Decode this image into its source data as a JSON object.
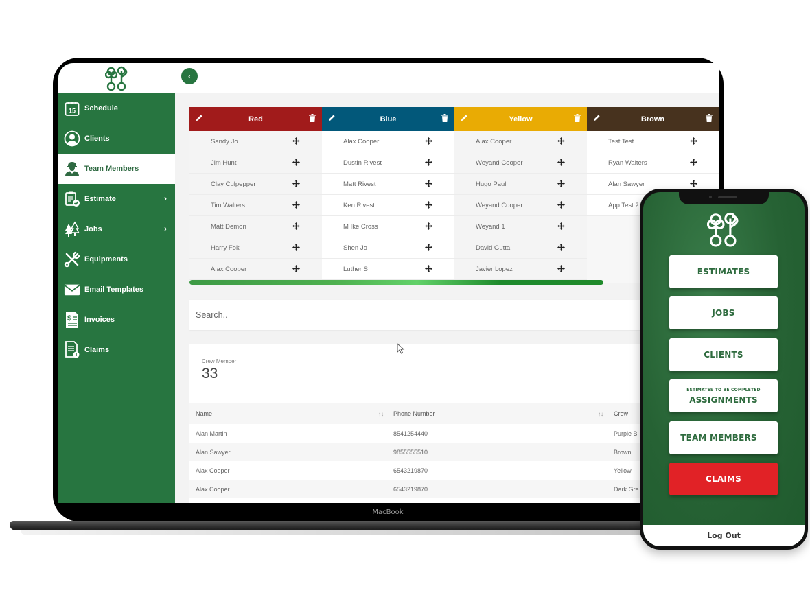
{
  "device": {
    "laptop_brand": "MacBook"
  },
  "sidebar": {
    "items": [
      {
        "label": "Schedule",
        "icon": "calendar-icon",
        "calendar_day": "15",
        "active": false,
        "has_submenu": false
      },
      {
        "label": "Clients",
        "icon": "user-circle-icon",
        "active": false,
        "has_submenu": false
      },
      {
        "label": "Team Members",
        "icon": "worker-icon",
        "active": true,
        "has_submenu": false
      },
      {
        "label": "Estimate",
        "icon": "clipboard-check-icon",
        "active": false,
        "has_submenu": true
      },
      {
        "label": "Jobs",
        "icon": "trees-icon",
        "active": false,
        "has_submenu": true
      },
      {
        "label": "Equipments",
        "icon": "tools-icon",
        "active": false,
        "has_submenu": false
      },
      {
        "label": "Email Templates",
        "icon": "envelope-icon",
        "active": false,
        "has_submenu": false
      },
      {
        "label": "Invoices",
        "icon": "invoice-icon",
        "active": false,
        "has_submenu": false
      },
      {
        "label": "Claims",
        "icon": "claims-doc-icon",
        "active": false,
        "has_submenu": false
      }
    ],
    "chevron": "›"
  },
  "topbar": {
    "back_glyph": "‹"
  },
  "crews": [
    {
      "name": "Red",
      "color": "#a11b1b",
      "members": [
        "Sandy Jo",
        "Jim Hunt",
        "Clay Culpepper",
        "Tim Walters",
        "Matt Demon",
        "Harry Fok",
        "Alax Cooper"
      ]
    },
    {
      "name": "Blue",
      "color": "#02587a",
      "members": [
        "Alax Cooper",
        "Dustin Rivest",
        "Matt Rivest",
        "Ken Rivest",
        "M Ike Cross",
        "Shen Jo",
        "Luther S"
      ]
    },
    {
      "name": "Yellow",
      "color": "#e9ab04",
      "members": [
        "Alax Cooper",
        "Weyand Cooper",
        "Hugo Paul",
        "Weyand Cooper",
        "Weyand 1",
        "David Gutta",
        "Javier Lopez"
      ]
    },
    {
      "name": "Brown",
      "color": "#47321e",
      "members": [
        "Test Test",
        "Ryan Walters",
        "Alan Sawyer",
        "App Test 2"
      ]
    }
  ],
  "search": {
    "placeholder": "Search.."
  },
  "stats": {
    "label": "Crew Member",
    "value": "33"
  },
  "table": {
    "headers": [
      "Name",
      "Phone Number",
      "Crew"
    ],
    "sort_glyph": "↑↓",
    "rows": [
      [
        "Alan Martin",
        "8541254440",
        "Purple B"
      ],
      [
        "Alan Sawyer",
        "9855555510",
        "Brown"
      ],
      [
        "Alax Cooper",
        "6543219870",
        "Yellow"
      ],
      [
        "Alax Cooper",
        "6543219870",
        "Dark Gre"
      ]
    ]
  },
  "phone": {
    "buttons": [
      {
        "label": "ESTIMATES",
        "sub": ""
      },
      {
        "label": "JOBS",
        "sub": ""
      },
      {
        "label": "CLIENTS",
        "sub": ""
      },
      {
        "label": "ASSIGNMENTS",
        "sub": "ESTIMATES TO BE COMPLETED"
      },
      {
        "label": "TEAM MEMBERS",
        "sub": ""
      },
      {
        "label": "CLAIMS",
        "sub": ""
      }
    ],
    "logout": "Log Out",
    "colors": {
      "brand_green": "#277540",
      "claims_red": "#e12226"
    }
  }
}
